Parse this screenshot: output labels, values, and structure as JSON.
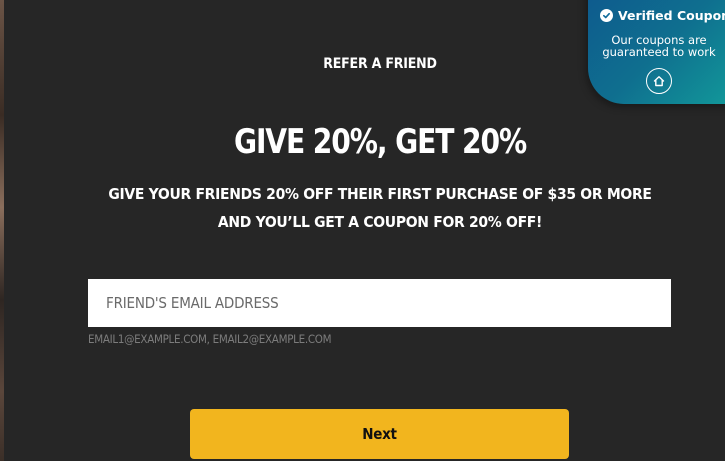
{
  "modal": {
    "eyebrow": "REFER A FRIEND",
    "headline": "GIVE 20%, GET 20%",
    "description": "GIVE YOUR FRIENDS 20% OFF THEIR FIRST PURCHASE OF $35 OR MORE AND YOU’LL GET A COUPON FOR 20% OFF!",
    "email_field": {
      "placeholder": "FRIEND'S EMAIL ADDRESS",
      "value": ""
    },
    "helper_text": "EMAIL1@EXAMPLE.COM, EMAIL2@EXAMPLE.COM",
    "next_label": "Next"
  },
  "badge": {
    "title": "Verified Coupon",
    "subtitle": "Our coupons are guaranteed to work",
    "icons": [
      "check-circle-icon",
      "home-icon"
    ]
  },
  "colors": {
    "background": "#262626",
    "button": "#f2b51e",
    "badge_start": "#0e5a8e",
    "badge_end": "#129a9a"
  }
}
